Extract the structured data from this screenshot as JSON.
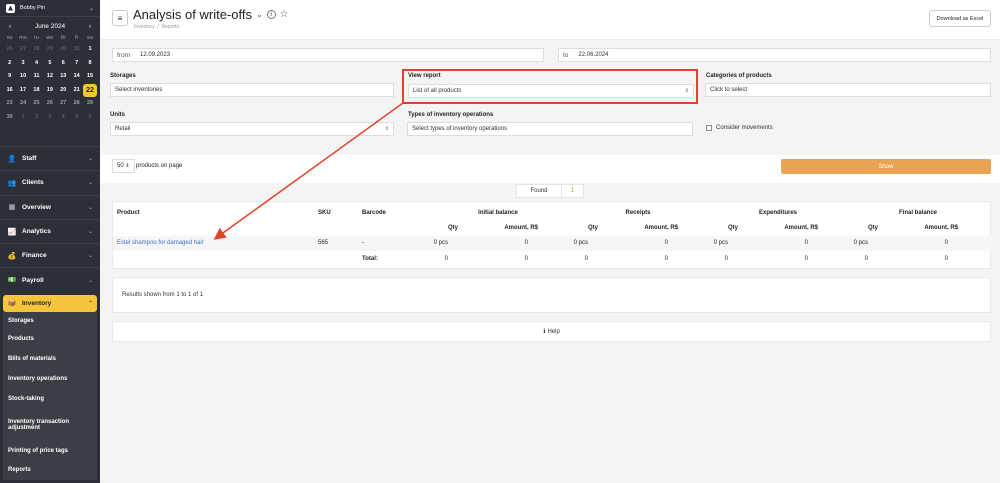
{
  "account": {
    "name": "Bobby Pin"
  },
  "calendar": {
    "month_label": "June 2024",
    "prev": "‹",
    "next": "›",
    "weekdays": [
      "su",
      "mo",
      "tu",
      "we",
      "th",
      "fr",
      "sa"
    ],
    "weeks": [
      [
        "26",
        "27",
        "28",
        "29",
        "30",
        "31",
        "1"
      ],
      [
        "2",
        "3",
        "4",
        "5",
        "6",
        "7",
        "8"
      ],
      [
        "9",
        "10",
        "11",
        "12",
        "13",
        "14",
        "15"
      ],
      [
        "16",
        "17",
        "18",
        "19",
        "20",
        "21",
        "22"
      ],
      [
        "23",
        "24",
        "25",
        "26",
        "27",
        "28",
        "29"
      ],
      [
        "30",
        "1",
        "2",
        "3",
        "4",
        "5",
        "6"
      ]
    ]
  },
  "nav": [
    {
      "label": "Staff",
      "icon": "👤"
    },
    {
      "label": "Clients",
      "icon": "👥"
    },
    {
      "label": "Overview",
      "icon": "▦"
    },
    {
      "label": "Analytics",
      "icon": "📈"
    },
    {
      "label": "Finance",
      "icon": "💰"
    },
    {
      "label": "Payroll",
      "icon": "💵"
    }
  ],
  "inventory": {
    "label": "Inventory",
    "icon": "📦",
    "subitems": [
      "Storages",
      "Products",
      "Bills of materials",
      "Inventory operations",
      "Stock-taking",
      "Inventory transaction adjustment",
      "Printing of price tags",
      "Reports"
    ]
  },
  "header": {
    "title": "Analysis of write-offs",
    "breadcrumb_1": "Inventory",
    "breadcrumb_2": "Reports",
    "breadcrumb_sep": "/",
    "excel_button": "Download as Excel"
  },
  "filters": {
    "from_label": "from",
    "from_value": "12.09.2023",
    "to_label": "to",
    "to_value": "22.06.2024",
    "storages_label": "Storages",
    "storages_placeholder": "Select inventories",
    "view_report_label": "View report",
    "view_report_value": "List of all products",
    "categories_label": "Categories of products",
    "categories_placeholder": "Click to select",
    "units_label": "Units",
    "units_value": "Retail",
    "op_types_label": "Types of inventory operations",
    "op_types_placeholder": "Select types of inventory operations",
    "consider_movements": "Consider movements"
  },
  "paging": {
    "per_page": "50",
    "per_page_label": "products on page",
    "show_button": "Show"
  },
  "found": {
    "label": "Found",
    "count": "1"
  },
  "table": {
    "groups": [
      "Initial balance",
      "Receipts",
      "Expenditures",
      "Final balance"
    ],
    "col_product": "Product",
    "col_sku": "SKU",
    "col_barcode": "Barcode",
    "col_qty": "Qty",
    "col_amount": "Amount, R$",
    "rows": [
      {
        "product": "Estel shampoo for damaged hair",
        "sku": "565",
        "barcode": "-",
        "vals": [
          "0 pcs",
          "0",
          "0 pcs",
          "0",
          "0 pcs",
          "0",
          "0 pcs",
          "0"
        ]
      }
    ],
    "total_label": "Total:",
    "totals": [
      "0",
      "0",
      "0",
      "0",
      "0",
      "0",
      "0",
      "0"
    ]
  },
  "results_text": "Results shown from 1 to 1 of 1",
  "help": {
    "icon": "ℹ",
    "label": "Help"
  },
  "colors": {
    "accent": "#f4c53a",
    "show_button": "#e8a452",
    "annotation": "#e0442a",
    "link": "#3b6fd0"
  }
}
